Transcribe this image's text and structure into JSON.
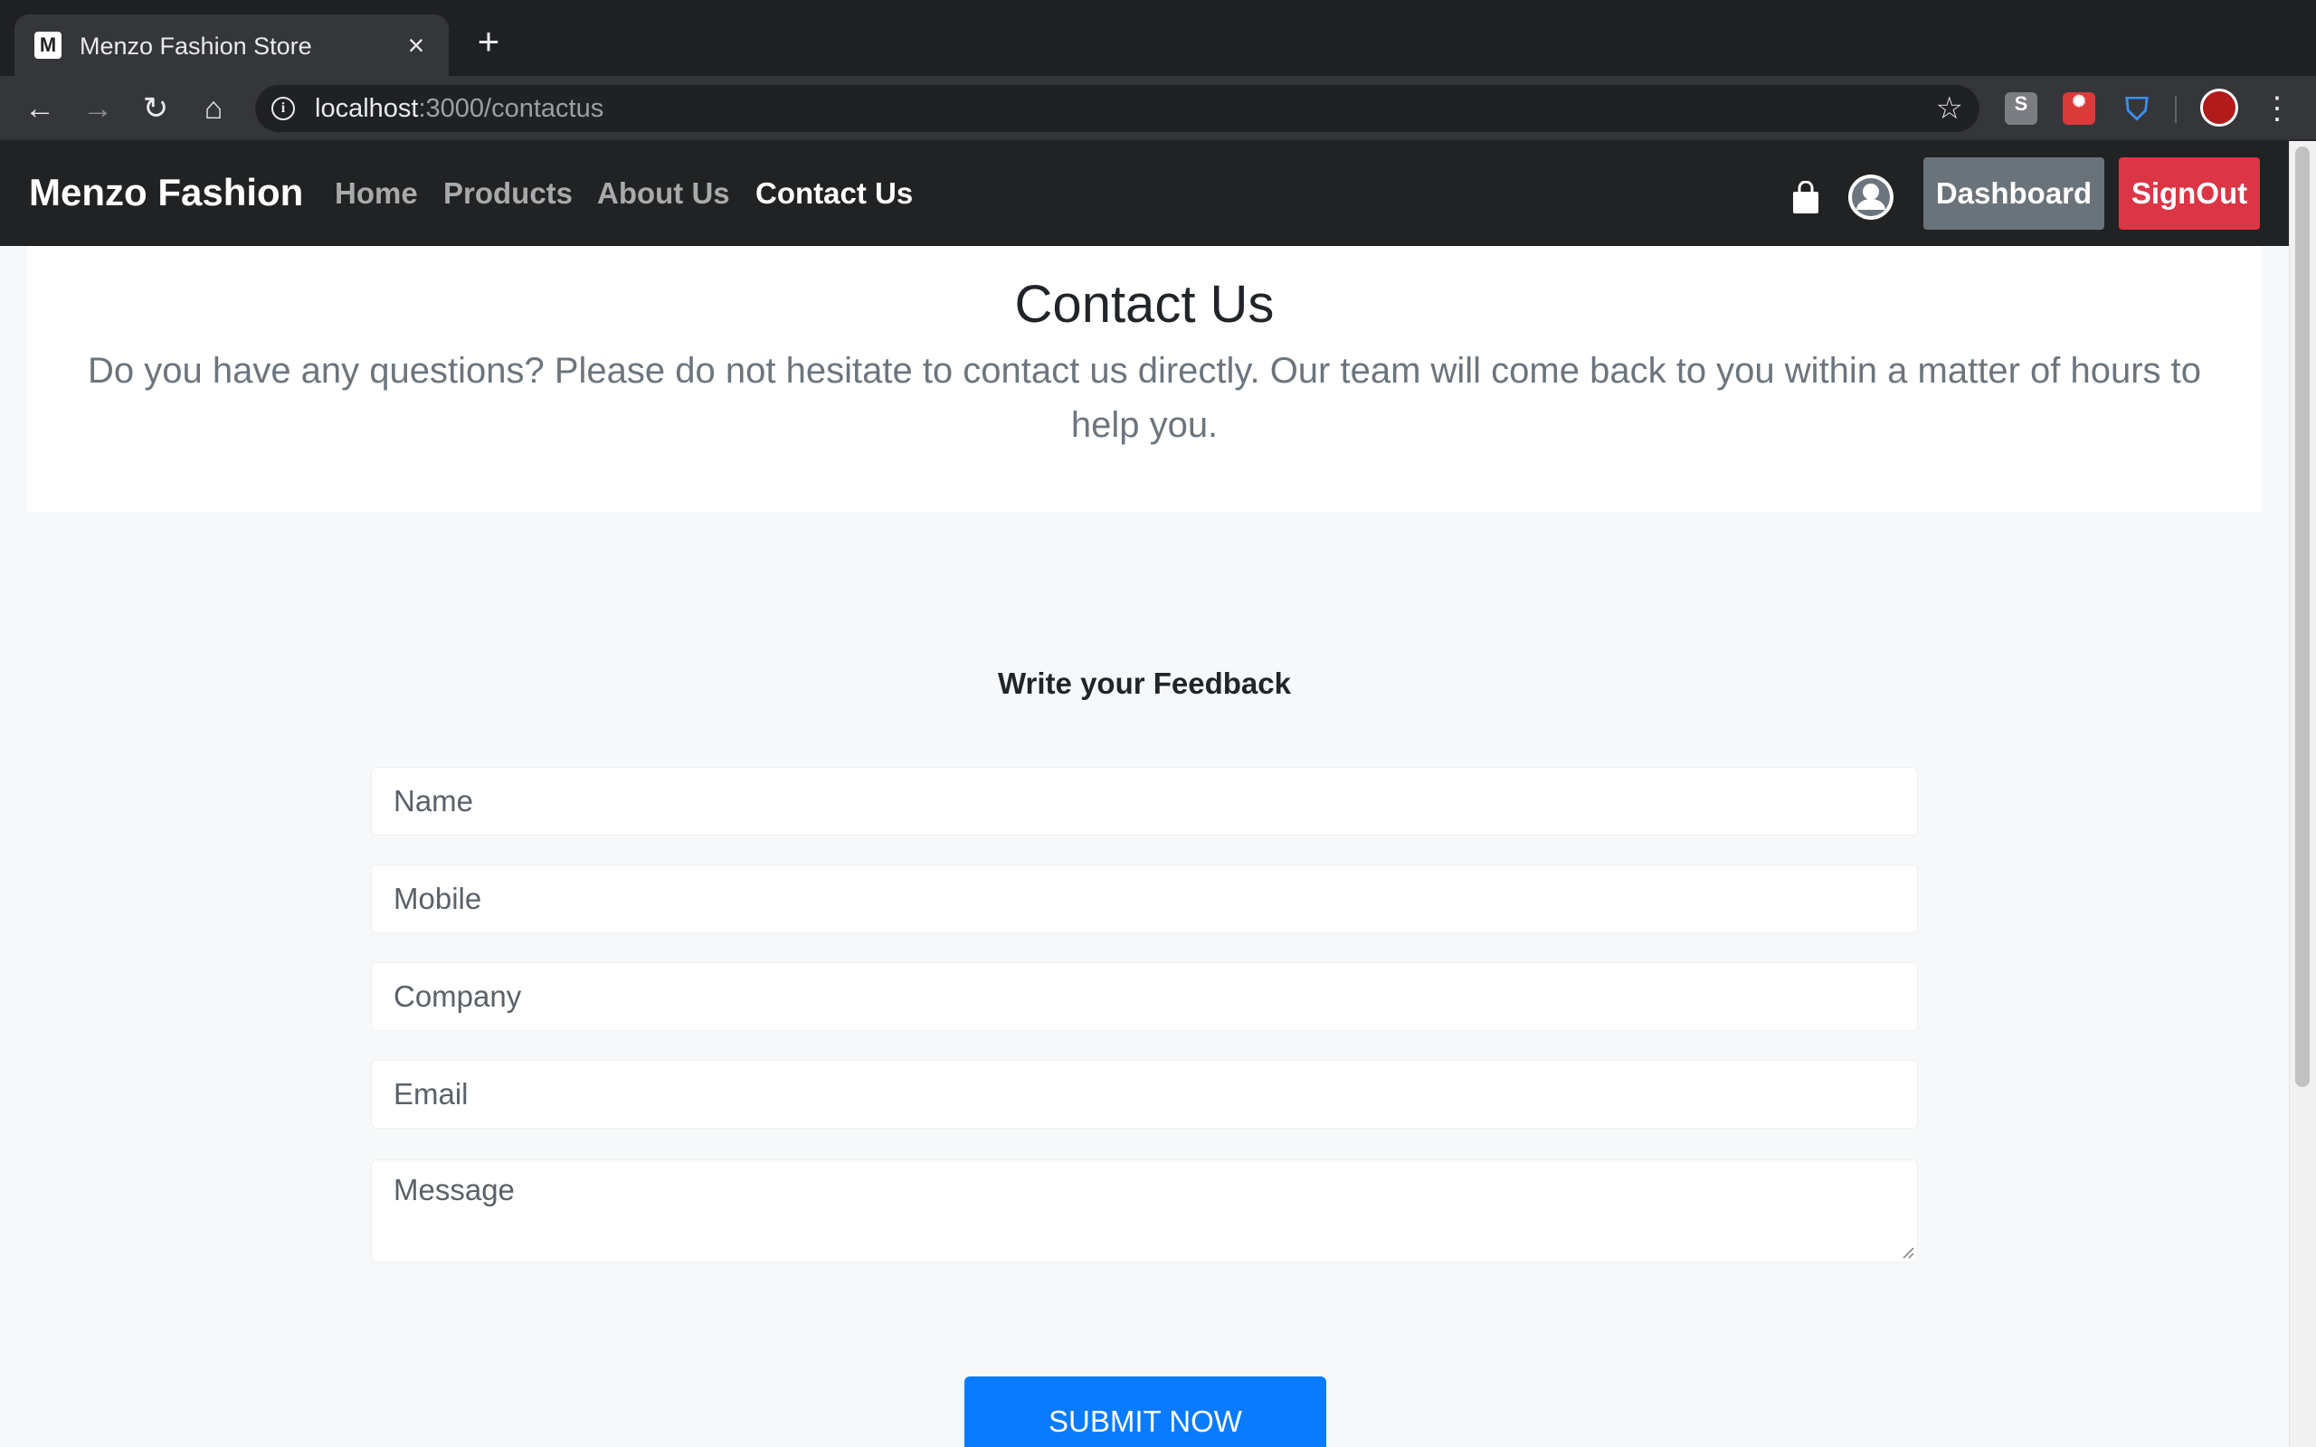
{
  "browser": {
    "tab_title": "Menzo Fashion Store",
    "favicon_letter": "M",
    "url_host": "localhost",
    "url_path": ":3000/contactus",
    "extensions": [
      "s-extension-icon",
      "bug-extension-icon",
      "shield-extension-icon"
    ]
  },
  "navbar": {
    "brand": "Menzo Fashion",
    "links": [
      "Home",
      "Products",
      "About Us",
      "Contact Us"
    ],
    "active_link": "Contact Us",
    "dashboard_label": "Dashboard",
    "signout_label": "SignOut"
  },
  "header": {
    "title": "Contact Us",
    "lead": "Do you have any questions? Please do not hesitate to contact us directly. Our team will come back to you within a matter of hours to help you."
  },
  "form": {
    "heading": "Write your Feedback",
    "name_placeholder": "Name",
    "mobile_placeholder": "Mobile",
    "company_placeholder": "Company",
    "email_placeholder": "Email",
    "message_placeholder": "Message",
    "submit_label": "SUBMIT NOW"
  },
  "colors": {
    "navbar_bg": "#212223",
    "dashboard_btn": "#6b737a",
    "signout_btn": "#dc3545",
    "submit_btn": "#0a7bff"
  }
}
